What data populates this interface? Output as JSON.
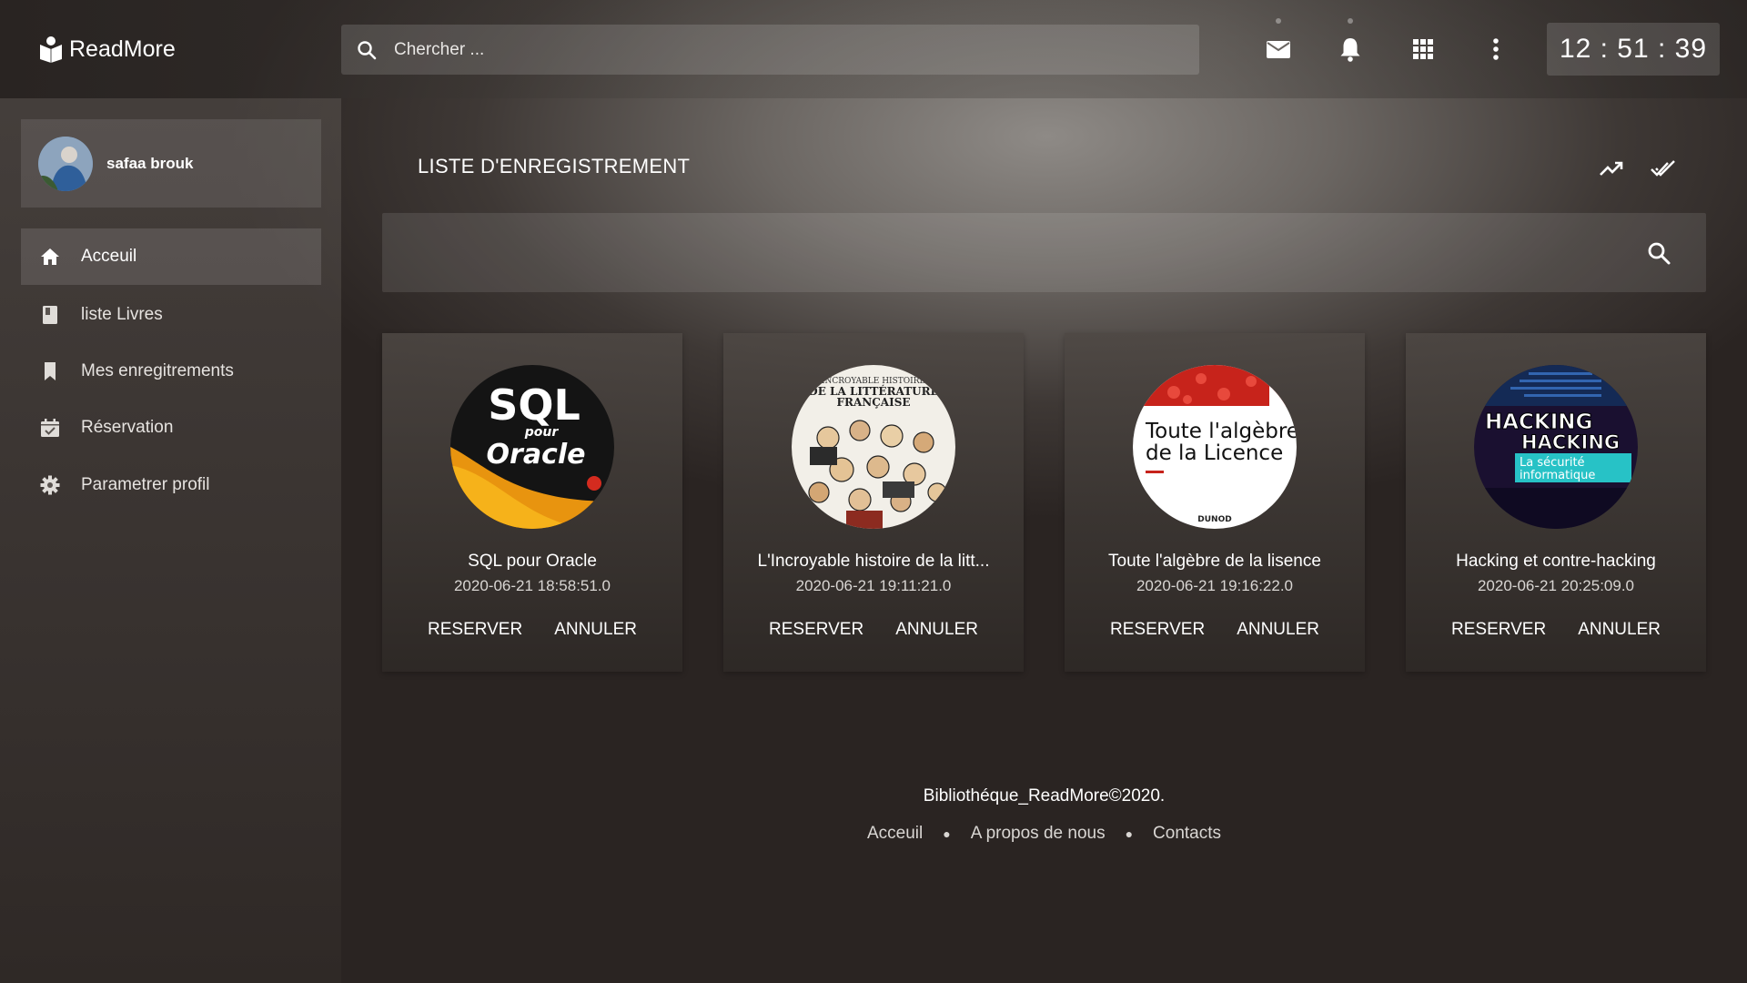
{
  "app": {
    "brand": "ReadMore",
    "search_placeholder": "Chercher ...",
    "clock": "12 : 51 : 39"
  },
  "header_icons": [
    "mail-icon",
    "bell-icon",
    "apps-grid-icon",
    "more-vert-icon"
  ],
  "sidebar": {
    "user_name": "safaa brouk",
    "items": [
      {
        "label": "Acceuil",
        "icon": "home-icon",
        "active": true
      },
      {
        "label": "liste Livres",
        "icon": "book-icon",
        "active": false
      },
      {
        "label": "Mes enregitrements",
        "icon": "bookmark-icon",
        "active": false
      },
      {
        "label": "Réservation",
        "icon": "calendar-check-icon",
        "active": false
      },
      {
        "label": "Parametrer profil",
        "icon": "gear-icon",
        "active": false
      }
    ]
  },
  "main": {
    "title": "LISTE D'ENREGISTREMENT",
    "header_icons": [
      "trending-up-icon",
      "done-all-icon"
    ],
    "filter_placeholder": "",
    "books": [
      {
        "title": "SQL pour Oracle",
        "date": "2020-06-21 18:58:51.0",
        "reserve": "RESERVER",
        "cancel": "ANNULER",
        "cover": {
          "line1": "SQL",
          "line2": "pour",
          "line3": "Oracle"
        }
      },
      {
        "title": "L'Incroyable histoire de la litt...",
        "date": "2020-06-21 19:11:21.0",
        "reserve": "RESERVER",
        "cancel": "ANNULER",
        "cover": {
          "line1": "INCROYABLE HISTOIRE",
          "line2": "DE LA LITTÉRATURE",
          "line3": "FRANÇAISE"
        }
      },
      {
        "title": "Toute l'algèbre de la lisence",
        "date": "2020-06-21 19:16:22.0",
        "reserve": "RESERVER",
        "cancel": "ANNULER",
        "cover": {
          "line1": "Toute l'algèbre",
          "line2": "de la Licence",
          "line3": "DUNOD"
        }
      },
      {
        "title": "Hacking et contre-hacking",
        "date": "2020-06-21 20:25:09.0",
        "reserve": "RESERVER",
        "cancel": "ANNULER",
        "cover": {
          "line1": "HACKING",
          "line2": "HACKING",
          "line3": "La sécurité",
          "line4": "informatique"
        }
      }
    ]
  },
  "footer": {
    "copyright": "Bibliothéque_ReadMore©2020.",
    "links": [
      "Acceuil",
      "A propos de nous",
      "Contacts"
    ]
  }
}
